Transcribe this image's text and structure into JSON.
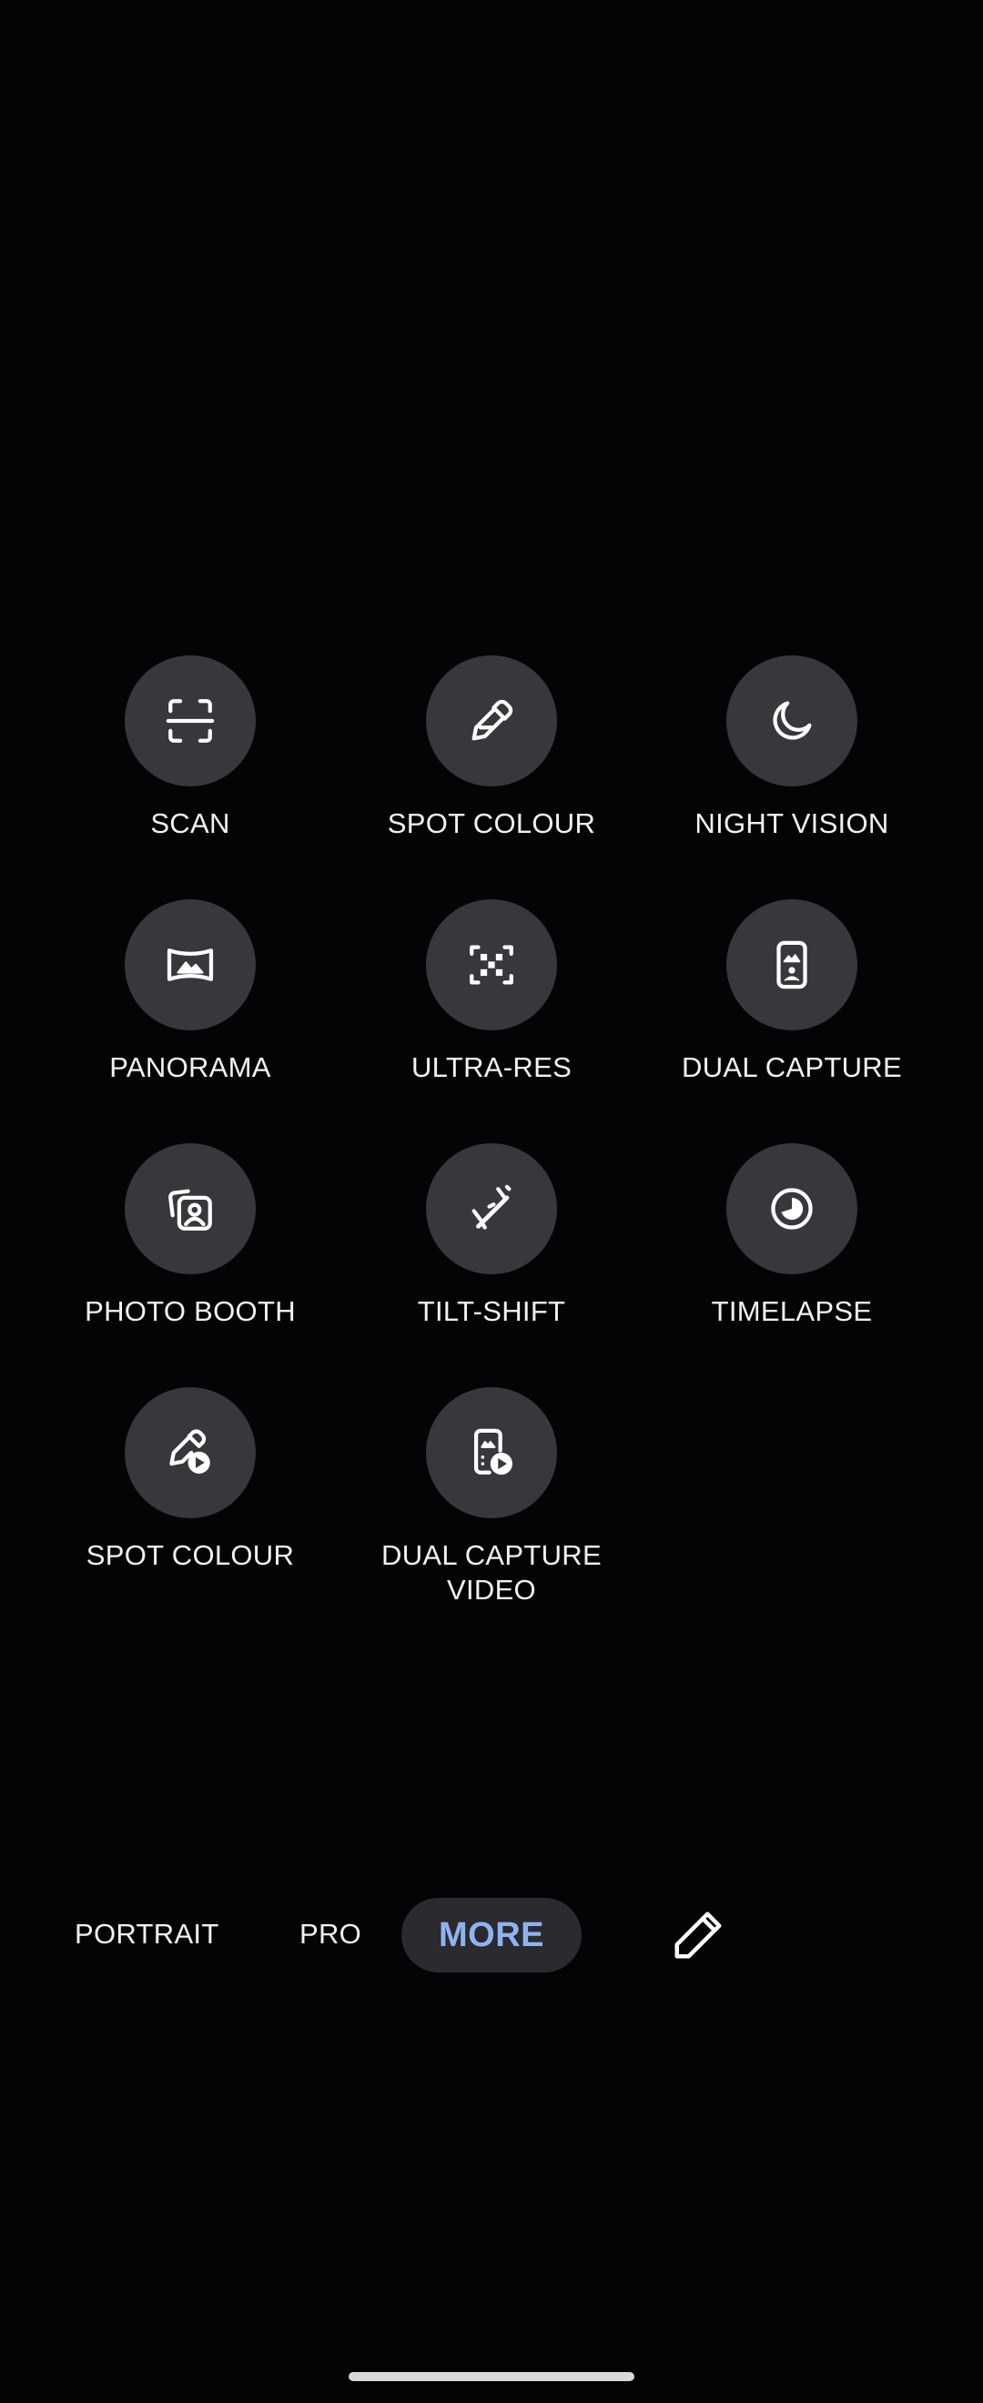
{
  "modes": [
    {
      "label_lines": [
        "SCAN"
      ],
      "icon": "scan-icon"
    },
    {
      "label_lines": [
        "SPOT COLOUR"
      ],
      "icon": "eyedropper-icon"
    },
    {
      "label_lines": [
        "NIGHT VISION"
      ],
      "icon": "moon-icon"
    },
    {
      "label_lines": [
        "PANORAMA"
      ],
      "icon": "panorama-icon"
    },
    {
      "label_lines": [
        "ULTRA-RES"
      ],
      "icon": "ultra-res-icon"
    },
    {
      "label_lines": [
        "DUAL CAPTURE"
      ],
      "icon": "dual-capture-icon"
    },
    {
      "label_lines": [
        "PHOTO BOOTH"
      ],
      "icon": "photo-booth-icon"
    },
    {
      "label_lines": [
        "TILT-SHIFT"
      ],
      "icon": "tilt-shift-icon"
    },
    {
      "label_lines": [
        "TIMELAPSE"
      ],
      "icon": "timelapse-icon"
    },
    {
      "label_lines": [
        "SPOT COLOUR"
      ],
      "icon": "spot-colour-video-icon"
    },
    {
      "label_lines": [
        "DUAL CAPTURE",
        "VIDEO"
      ],
      "icon": "dual-capture-video-icon"
    }
  ],
  "mode_bar": {
    "portrait": "PORTRAIT",
    "pro": "PRO",
    "more": "MORE",
    "edit_icon": "pencil-icon"
  },
  "colors": {
    "background": "#050306",
    "circle": "#39373c",
    "active_text": "#8fb3f0",
    "active_pill": "#2b2a2f"
  }
}
